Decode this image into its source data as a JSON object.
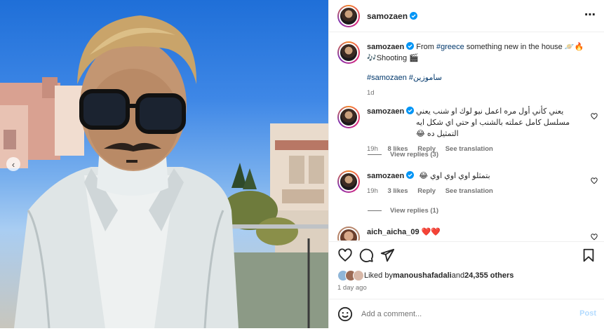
{
  "post": {
    "username": "samozaen",
    "more_icon": "more-horizontal-icon"
  },
  "caption": {
    "username": "samozaen",
    "text_part1": "From ",
    "hashtag_greece": "#greece",
    "text_part2": " something new in the house 🪐🔥",
    "text_line2": "🎶Shooting 🎬",
    "hashtags": "#samozaen #ساموزين",
    "time": "1d"
  },
  "comments": [
    {
      "username": "samozaen",
      "text": "يعني كأني أول مره اعمل نيو لوك او شنب يعني مسلسل كامل عملته بالشنب او حتي اي شكل ايه التمثيل ده 😂",
      "time": "19h",
      "likes": "8 likes",
      "reply": "Reply",
      "translate": "See translation",
      "view_replies": "View replies (3)"
    },
    {
      "username": "samozaen",
      "text": "بتمثلو اوي اوي اوي 😂",
      "time": "19h",
      "likes": "3 likes",
      "reply": "Reply",
      "translate": "See translation",
      "view_replies": "View replies (1)"
    },
    {
      "username": "aich_aicha_09",
      "text": "❤️❤️"
    }
  ],
  "likes": {
    "prefix": "Liked by ",
    "user": "manoushafadali",
    "middle": " and ",
    "count": "24,355 others"
  },
  "time_ago": "1 day ago",
  "add_comment": {
    "placeholder": "Add a comment...",
    "post_label": "Post"
  },
  "colors": {
    "link": "#00376b",
    "secondary": "#737373",
    "post_disabled": "#b3dbff",
    "verified": "#0095f6"
  }
}
